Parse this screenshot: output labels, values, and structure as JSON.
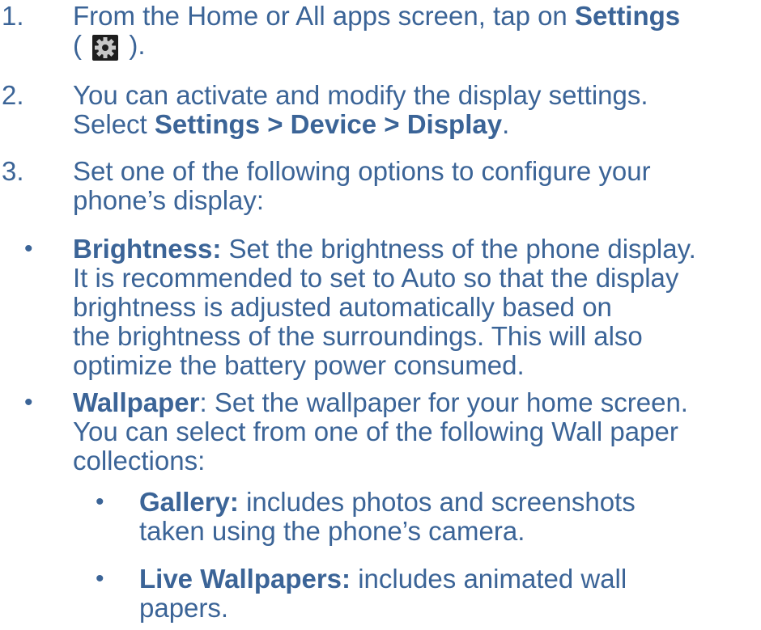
{
  "steps": [
    {
      "num": "1.",
      "pre": "From the Home or All apps screen, tap on ",
      "bold": "Settings",
      "paren_open": "(",
      "icon": "settings-gear-icon",
      "paren_close": ")."
    },
    {
      "num": "2.",
      "line1": "You can activate and modify the display settings.",
      "pre": "Select ",
      "bold": "Settings > Device > Display",
      "post": "."
    },
    {
      "num": "3.",
      "line1": "Set one of the following options to configure your",
      "line2": "phone’s display:"
    }
  ],
  "options": [
    {
      "bullet": "•",
      "title": "Brightness:",
      "lines": [
        " Set the brightness of the phone display.",
        "It is recommended to set to Auto so that the display",
        "brightness is adjusted automatically based on",
        "the brightness of the surroundings. This will also",
        "optimize the battery power consumed."
      ]
    },
    {
      "bullet": "•",
      "title": "Wallpaper",
      "lines": [
        ": Set the wallpaper for your home screen.",
        "You can select from one of the following Wall paper",
        "collections:"
      ]
    }
  ],
  "sub_options": [
    {
      "bullet": "•",
      "title": "Gallery:",
      "lines": [
        " includes photos and screenshots",
        "taken using the phone’s camera."
      ]
    },
    {
      "bullet": "•",
      "title": "Live Wallpapers:",
      "lines": [
        " includes animated wall",
        "papers."
      ]
    }
  ]
}
